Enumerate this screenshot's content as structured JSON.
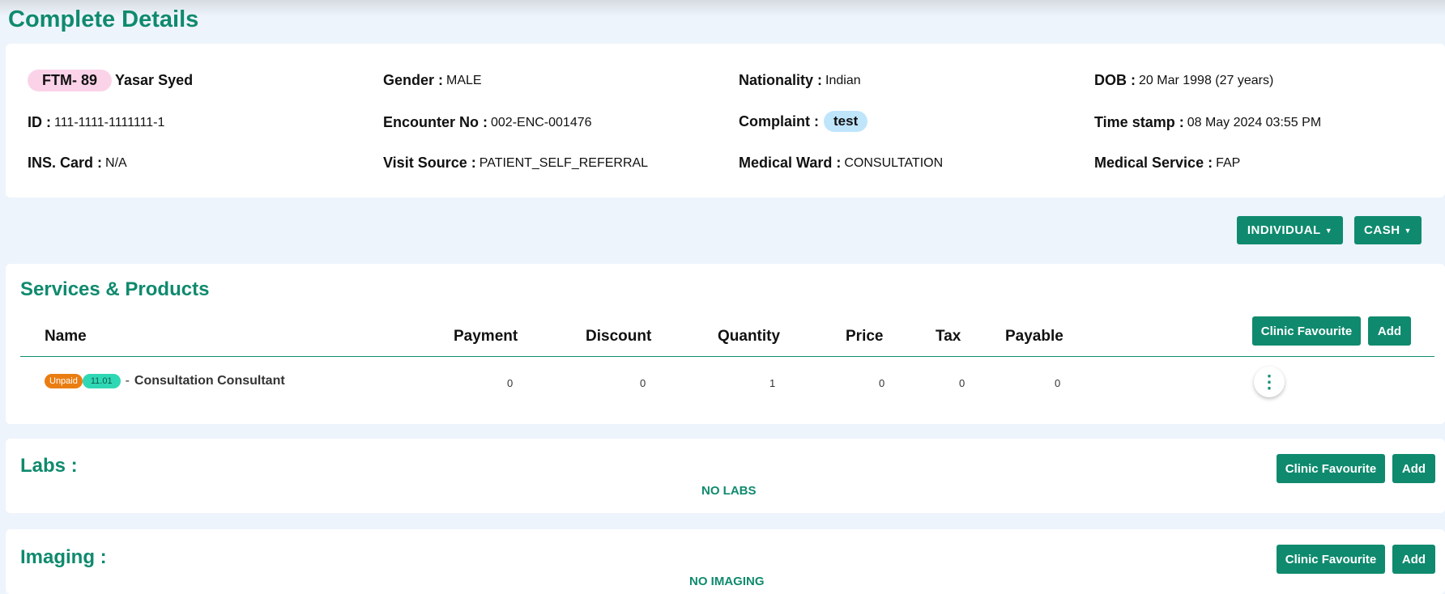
{
  "page": {
    "title": "Complete Details"
  },
  "patient": {
    "ftm_badge": "FTM-  89",
    "name": "Yasar Syed",
    "gender_label": "Gender :",
    "gender": "MALE",
    "nationality_label": "Nationality :",
    "nationality": "Indian",
    "dob_label": "DOB :",
    "dob": "20 Mar 1998 (27 years)",
    "id_label": "ID :",
    "id": "111-1111-1111111-1",
    "encounter_label": "Encounter No :",
    "encounter": "002-ENC-001476",
    "complaint_label": "Complaint :",
    "complaint": "test",
    "timestamp_label": "Time stamp :",
    "timestamp": "08 May 2024 03:55 PM",
    "ins_label": "INS. Card :",
    "ins": "N/A",
    "visit_source_label": "Visit Source :",
    "visit_source": "PATIENT_SELF_REFERRAL",
    "ward_label": "Medical Ward :",
    "ward": "CONSULTATION",
    "service_label": "Medical Service :",
    "service": "FAP"
  },
  "toolbar": {
    "individual": "INDIVIDUAL",
    "cash": "CASH"
  },
  "services": {
    "title": "Services & Products",
    "columns": [
      "Name",
      "Payment",
      "Discount",
      "Quantity",
      "Price",
      "Tax",
      "Payable"
    ],
    "clinic_favourite": "Clinic Favourite",
    "add": "Add",
    "rows": [
      {
        "status": "Unpaid",
        "code": "11.01",
        "dash": "-",
        "name": "Consultation Consultant",
        "payment": "0",
        "discount": "0",
        "quantity": "1",
        "price": "0",
        "tax": "0",
        "payable": "0"
      }
    ]
  },
  "labs": {
    "title": "Labs :",
    "empty": "NO LABS",
    "clinic_favourite": "Clinic Favourite",
    "add": "Add"
  },
  "imaging": {
    "title": "Imaging :",
    "empty": "NO IMAGING",
    "clinic_favourite": "Clinic Favourite",
    "add": "Add"
  },
  "icons": {
    "row_menu": "kebab-menu-icon",
    "dropdown": "caret-down-icon"
  },
  "colors": {
    "accent": "#0f8a6e",
    "unpaid": "#ea7d12",
    "code": "#2fd8b4",
    "ftm": "#fbd3e9",
    "complaint": "#bfe5fb"
  }
}
